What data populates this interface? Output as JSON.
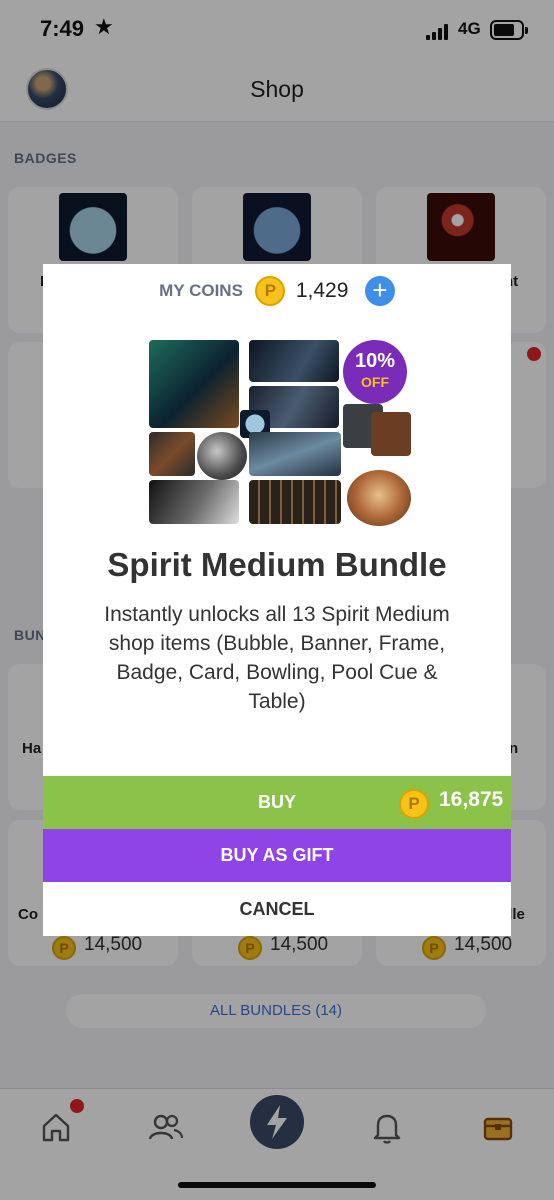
{
  "status_bar": {
    "time": "7:49",
    "network": "4G"
  },
  "header": {
    "title": "Shop"
  },
  "sections": {
    "badges": "BADGES",
    "bundles_partial": "BUN"
  },
  "background_cards": {
    "badge_right_partial": "nt",
    "badge_left_partial": "I",
    "bundle_left_partial": "Ha",
    "bundle_right_partial": "n",
    "bundle2_left_partial": "Co",
    "bundle2_right_partial": "ndle",
    "prices": [
      "14,500",
      "14,500",
      "14,500"
    ]
  },
  "all_bundles": "ALL BUNDLES (14)",
  "modal": {
    "coins_label": "MY COINS",
    "coins_value": "1,429",
    "add_label": "+",
    "discount_pct": "10%",
    "discount_off": "OFF",
    "title": "Spirit Medium Bundle",
    "description": "Instantly unlocks all 13 Spirit Medium shop items (Bubble, Banner, Frame, Badge, Card, Bowling, Pool Cue & Table)",
    "buy_label": "BUY",
    "buy_price": "16,875",
    "gift_label": "BUY AS GIFT",
    "cancel_label": "CANCEL",
    "coin_symbol": "P"
  },
  "colors": {
    "buy": "#8bc34a",
    "gift": "#8e44e6",
    "coin": "#f7c21a",
    "add": "#3f8ee8",
    "notification": "#e02424"
  },
  "icons": {
    "tabs": [
      "home-icon",
      "friends-icon",
      "lightning-icon",
      "bell-icon",
      "treasure-chest-icon"
    ]
  }
}
